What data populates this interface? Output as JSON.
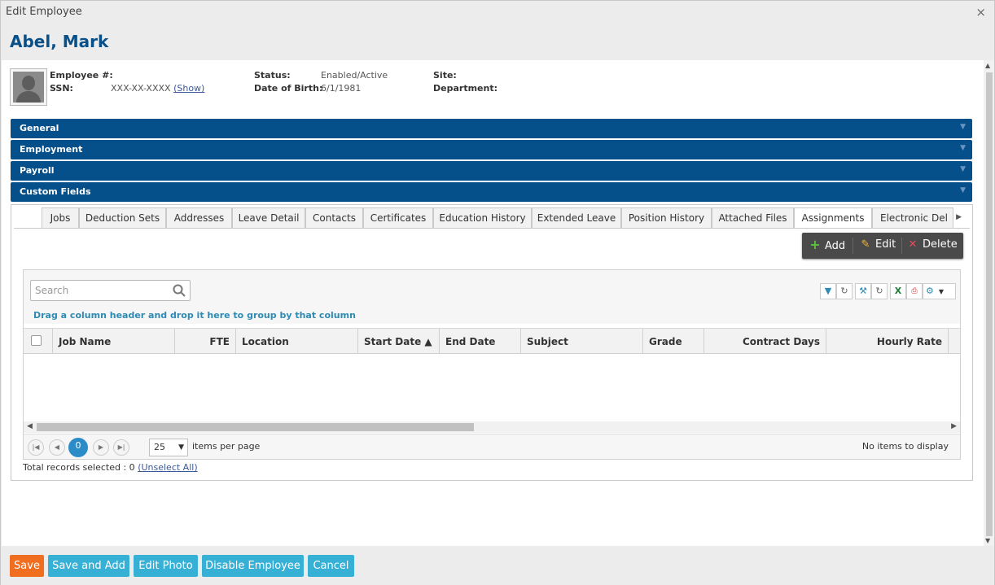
{
  "window": {
    "title": "Edit Employee",
    "close_glyph": "×"
  },
  "employee": {
    "name": "Abel, Mark",
    "fields": {
      "employee_num_label": "Employee #:",
      "employee_num_value": "",
      "ssn_label": "SSN:",
      "ssn_value": "XXX-XX-XXXX",
      "ssn_show_link": "(Show)",
      "status_label": "Status:",
      "status_value": "Enabled/Active",
      "dob_label": "Date of Birth:",
      "dob_value": "6/1/1981",
      "site_label": "Site:",
      "site_value": "",
      "department_label": "Department:",
      "department_value": ""
    }
  },
  "sections": [
    "General",
    "Employment",
    "Payroll",
    "Custom Fields"
  ],
  "tabs": [
    "Jobs",
    "Deduction Sets",
    "Addresses",
    "Leave Detail",
    "Contacts",
    "Certificates",
    "Education History",
    "Extended Leave",
    "Position History",
    "Attached Files",
    "Assignments",
    "Electronic Del"
  ],
  "active_tab": "Assignments",
  "actions": {
    "add": "Add",
    "edit": "Edit",
    "delete": "Delete"
  },
  "grid": {
    "search_placeholder": "Search",
    "group_hint": "Drag a column header and drop it here to group by that column",
    "columns": [
      "Job Name",
      "FTE",
      "Location",
      "Start Date ▲",
      "End Date",
      "Subject",
      "Grade",
      "Contract Days",
      "Hourly Rate"
    ],
    "rows": [],
    "pager": {
      "current_page": "0",
      "page_size": "25",
      "items_per_page_label": "items per page",
      "status": "No items to display"
    },
    "records_selected_label": "Total records selected : 0",
    "unselect_all_link": "(Unselect All)"
  },
  "footer_buttons": {
    "save": "Save",
    "save_and_add": "Save and Add",
    "edit_photo": "Edit Photo",
    "disable_employee": "Disable Employee",
    "cancel": "Cancel"
  },
  "colors": {
    "section_blue": "#05508a",
    "name_blue": "#08508a",
    "save_orange": "#f06e1f",
    "button_teal": "#37b0d6",
    "pager_active": "#2b8cc8"
  }
}
